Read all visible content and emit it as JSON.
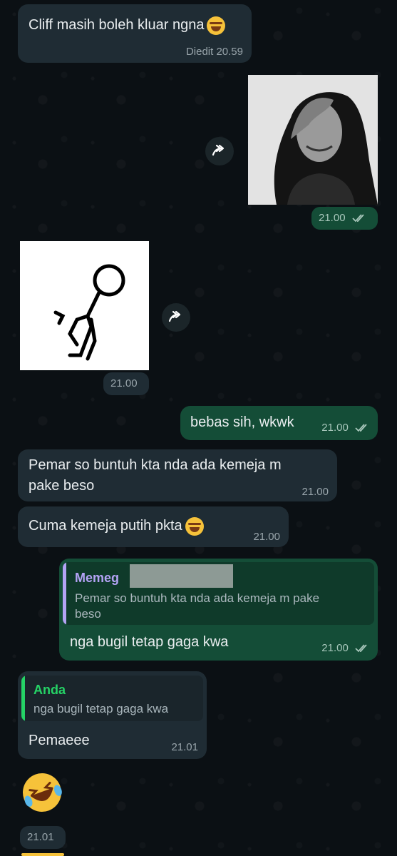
{
  "messages": {
    "m1": {
      "text": "Cliff masih boleh kluar ngna",
      "emoji": "rolling-on-floor-laughing",
      "time": "Diedit 20.59"
    },
    "m2": {
      "time": "21.00"
    },
    "m3": {
      "time": "21.00"
    },
    "m4": {
      "text": "bebas sih, wkwk",
      "time": "21.00"
    },
    "m5": {
      "line1": "Pemar so buntuh kta nda ada kemeja m",
      "line2": "pake beso",
      "time": "21.00"
    },
    "m6": {
      "text": "Cuma kemeja putih pkta",
      "emoji": "rolling-on-floor-laughing",
      "time": "21.00"
    },
    "m7": {
      "quote_name": "Memeg",
      "quote_line1": "Pemar so buntuh kta nda ada kemeja m pake",
      "quote_line2": "beso",
      "text": "nga bugil tetap gaga kwa",
      "time": "21.00"
    },
    "m8": {
      "quote_name": "Anda",
      "quote_text": "nga bugil tetap gaga kwa",
      "text": "Pemaeee",
      "time": "21.01"
    },
    "m9": {
      "emoji": "rolling-on-floor-laughing",
      "time": "21.01"
    }
  },
  "colors": {
    "incoming_bubble": "#1f2c34",
    "outgoing_bubble": "#144d37",
    "quote_name_purple": "#b4a3f5",
    "quote_name_green": "#53bdeb"
  },
  "icons": {
    "forward": "forward-icon",
    "read": "double-check-icon"
  }
}
